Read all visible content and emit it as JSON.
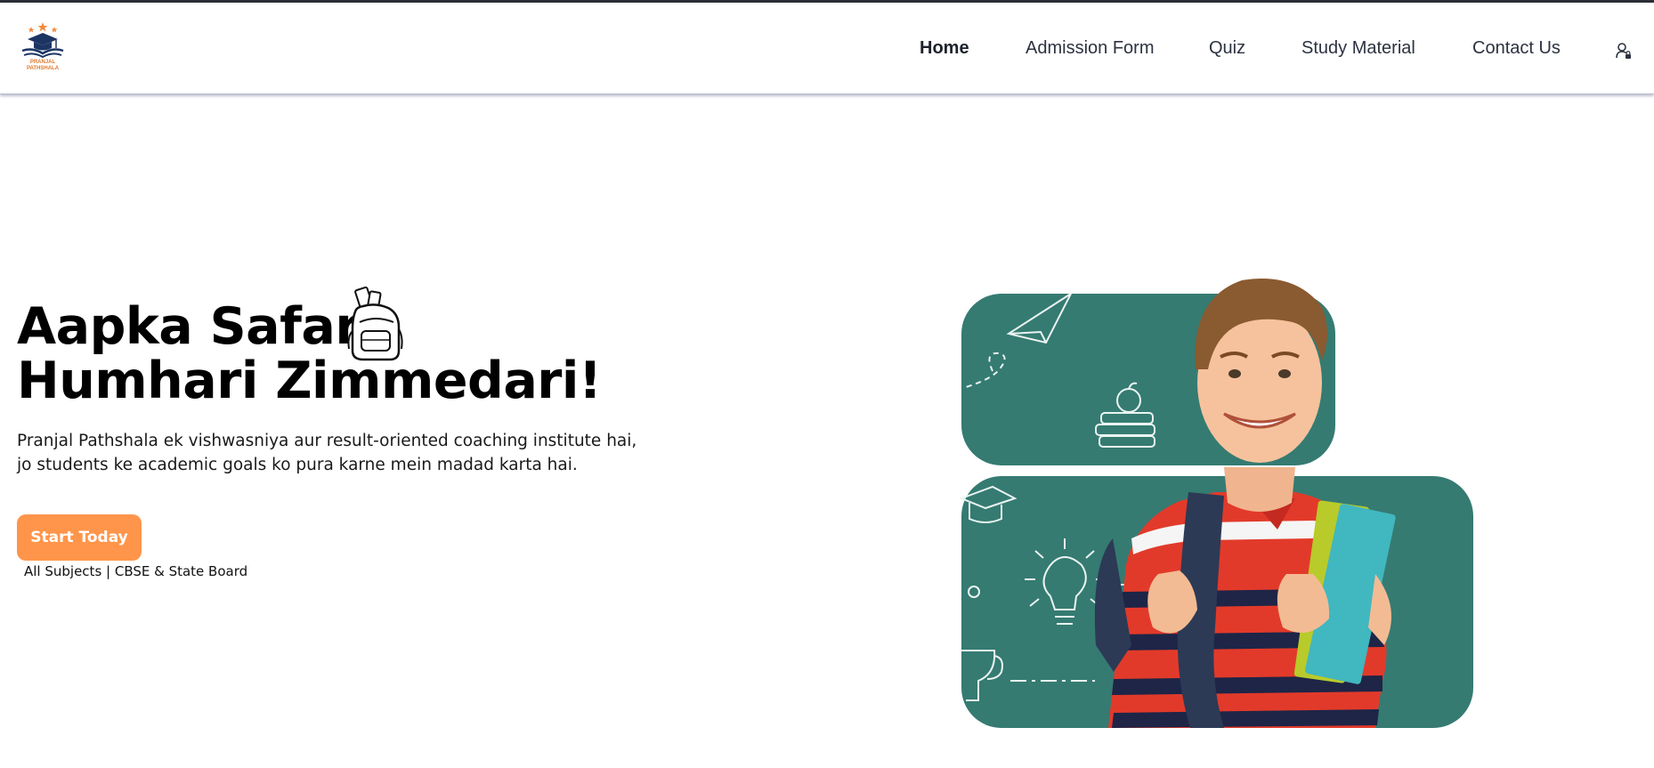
{
  "brand": {
    "logo_text_line1": "PRANJAL",
    "logo_text_line2": "PATHSHALA",
    "colors": {
      "navy": "#1c3563",
      "orange": "#f08a3c"
    }
  },
  "nav": {
    "items": [
      {
        "label": "Home",
        "active": true
      },
      {
        "label": "Admission Form"
      },
      {
        "label": "Quiz"
      },
      {
        "label": "Study Material"
      },
      {
        "label": "Contact Us"
      }
    ],
    "user_icon": "user-lock-icon"
  },
  "hero": {
    "title_line1": "Aapka Safar,",
    "title_line2": "Humhari Zimmedari!",
    "title_icon": "backpack-icon",
    "description": "Pranjal Pathshala ek vishwasniya aur result-oriented coaching institute hai, jo students ke academic goals ko pura karne mein madad karta hai.",
    "cta_label": "Start Today",
    "sub_note": "All Subjects | CBSE & State Board"
  },
  "colors": {
    "accent": "#ff954a",
    "panel": "#357b72",
    "text": "#000000"
  }
}
